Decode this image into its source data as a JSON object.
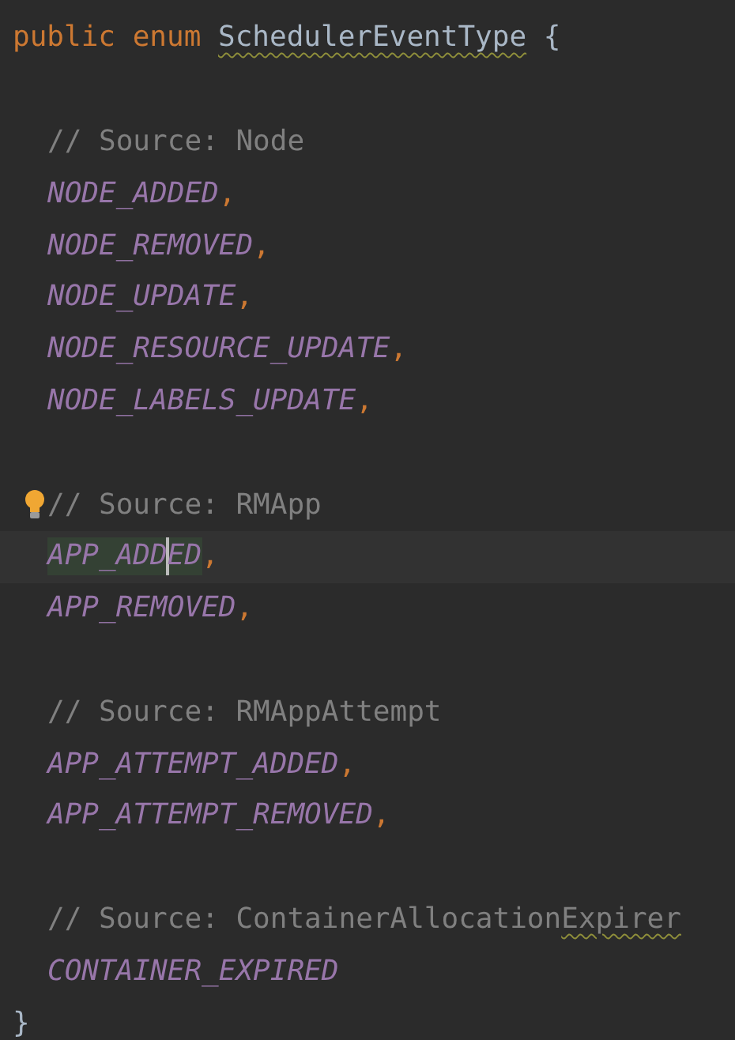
{
  "editor": {
    "declaration": {
      "tokens": [
        {
          "kind": "keyword",
          "text": "public"
        },
        {
          "kind": "keyword",
          "text": "enum"
        },
        {
          "kind": "type",
          "text": "SchedulerEventType",
          "typo": true
        },
        {
          "kind": "brace",
          "text": "{"
        }
      ]
    },
    "sections": [
      {
        "lines": [
          {
            "tokens": [
              {
                "kind": "comment",
                "text": "// Source: Node"
              }
            ]
          },
          {
            "tokens": [
              {
                "kind": "constant",
                "text": "NODE_ADDED"
              },
              {
                "kind": "comma",
                "text": ","
              }
            ]
          },
          {
            "tokens": [
              {
                "kind": "constant",
                "text": "NODE_REMOVED"
              },
              {
                "kind": "comma",
                "text": ","
              }
            ]
          },
          {
            "tokens": [
              {
                "kind": "constant",
                "text": "NODE_UPDATE"
              },
              {
                "kind": "comma",
                "text": ","
              }
            ]
          },
          {
            "tokens": [
              {
                "kind": "constant",
                "text": "NODE_RESOURCE_UPDATE"
              },
              {
                "kind": "comma",
                "text": ","
              }
            ]
          },
          {
            "tokens": [
              {
                "kind": "constant",
                "text": "NODE_LABELS_UPDATE"
              },
              {
                "kind": "comma",
                "text": ","
              }
            ]
          }
        ]
      },
      {
        "lines": [
          {
            "bulb": true,
            "tokens": [
              {
                "kind": "comment",
                "text": "// Source: RMApp"
              }
            ]
          },
          {
            "current": true,
            "tokens": [
              {
                "kind": "constant",
                "text": "APP_ADD",
                "text_after_caret": "ED",
                "highlighted": true
              },
              {
                "kind": "comma",
                "text": ","
              }
            ]
          },
          {
            "tokens": [
              {
                "kind": "constant",
                "text": "APP_REMOVED"
              },
              {
                "kind": "comma",
                "text": ","
              }
            ]
          }
        ]
      },
      {
        "lines": [
          {
            "tokens": [
              {
                "kind": "comment",
                "text": "// Source: RMAppAttempt"
              }
            ]
          },
          {
            "tokens": [
              {
                "kind": "constant",
                "text": "APP_ATTEMPT_ADDED"
              },
              {
                "kind": "comma",
                "text": ","
              }
            ]
          },
          {
            "tokens": [
              {
                "kind": "constant",
                "text": "APP_ATTEMPT_REMOVED"
              },
              {
                "kind": "comma",
                "text": ","
              }
            ]
          }
        ]
      },
      {
        "lines": [
          {
            "tokens": [
              {
                "kind": "comment",
                "text": "// Source: ContainerAllocation"
              },
              {
                "kind": "comment",
                "text": "Expirer",
                "typo": true
              }
            ]
          },
          {
            "tokens": [
              {
                "kind": "constant",
                "text": "CONTAINER_EXPIRED"
              }
            ]
          }
        ]
      }
    ],
    "closing": {
      "tokens": [
        {
          "kind": "brace",
          "text": "}"
        }
      ]
    }
  }
}
